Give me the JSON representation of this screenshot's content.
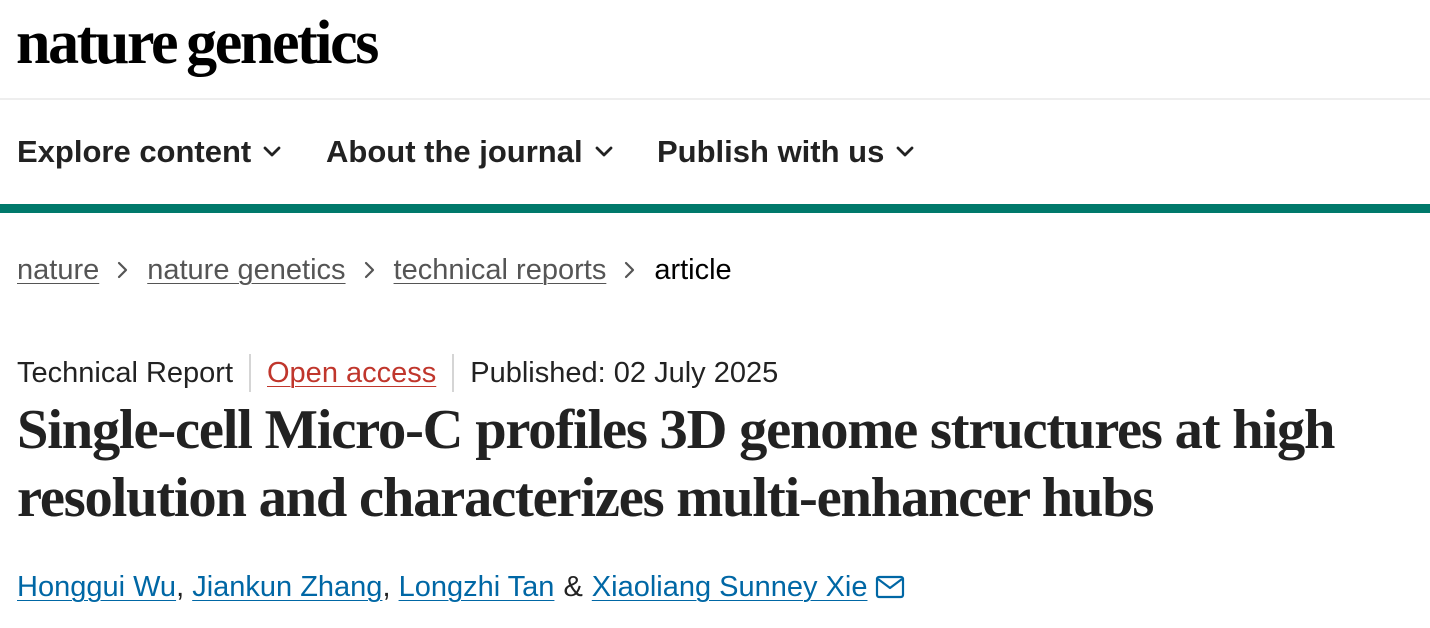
{
  "brand": {
    "word1": "nature",
    "word2": "genetics"
  },
  "nav": {
    "items": [
      {
        "label": "Explore content"
      },
      {
        "label": "About the journal"
      },
      {
        "label": "Publish with us"
      }
    ]
  },
  "colors": {
    "accent_rule": "#00796b",
    "open_access": "#c0362c",
    "author_link": "#0067a5",
    "breadcrumb_link": "#555555"
  },
  "breadcrumb": {
    "items": [
      "nature",
      "nature genetics",
      "technical reports"
    ],
    "current": "article"
  },
  "article": {
    "type": "Technical Report",
    "access": "Open access",
    "published": "Published: 02 July 2025",
    "title": "Single-cell Micro-C profiles 3D genome structures at high resolution and characterizes multi-enhancer hubs",
    "authors": [
      "Honggui Wu",
      "Jiankun Zhang",
      "Longzhi Tan",
      "Xiaoliang Sunney Xie"
    ],
    "author_separator": ",",
    "author_conjunction": "&"
  },
  "icons": {
    "nav_chevron": "chevron-down-icon",
    "breadcrumb_separator": "chevron-right-icon",
    "corresponding_author": "mail-icon"
  }
}
